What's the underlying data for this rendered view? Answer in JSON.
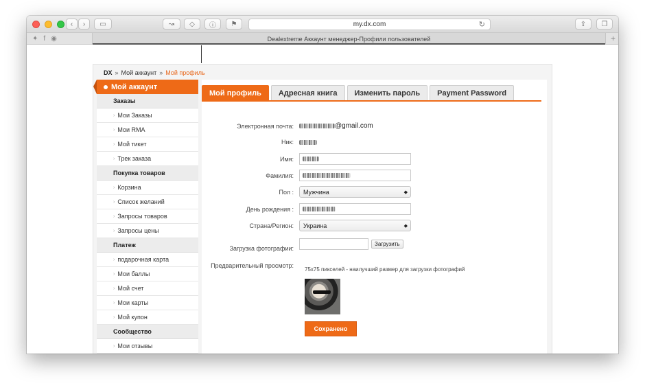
{
  "browser": {
    "url": "my.dx.com",
    "tab_title": "Dealextreme Аккаунт менеджер-Профили пользователей"
  },
  "breadcrumb": {
    "root": "DX",
    "sep": "»",
    "account": "Мой аккаунт",
    "current": "Мой профиль"
  },
  "sidebar": {
    "title": "Мой аккаунт",
    "groups": [
      {
        "title": "Заказы",
        "items": [
          "Мои Заказы",
          "Мои RMA",
          "Мой тикет",
          "Трек заказа"
        ]
      },
      {
        "title": "Покупка товаров",
        "items": [
          "Корзина",
          "Список желаний",
          "Запросы товаров",
          "Запросы цены"
        ]
      },
      {
        "title": "Платеж",
        "items": [
          "подарочная карта",
          "Мои баллы",
          "Мой счет",
          "Мои карты",
          "Мой купон"
        ]
      },
      {
        "title": "Сообщество",
        "items": [
          "Мои отзывы"
        ]
      }
    ]
  },
  "tabs": [
    "Мой профиль",
    "Адресная книга",
    "Изменить пароль",
    "Payment Password"
  ],
  "form": {
    "email_label": "Электронная почта:",
    "email_value": "@gmail.com",
    "nick_label": "Ник:",
    "name_label": "Имя:",
    "surname_label": "Фамилия:",
    "gender_label": "Пол :",
    "gender_value": "Мужчина",
    "birthday_label": "День рождения :",
    "country_label": "Страна/Регион:",
    "country_value": "Украина",
    "upload_label": "Загрузка фотографии:",
    "upload_button": "Загрузить",
    "upload_hint": "75x75 пикселей - наилучший размер для загрузки фотографий",
    "preview_label": "Предварительный просмотр:",
    "save_button": "Сохранено"
  },
  "colors": {
    "accent": "#ee6a17"
  }
}
